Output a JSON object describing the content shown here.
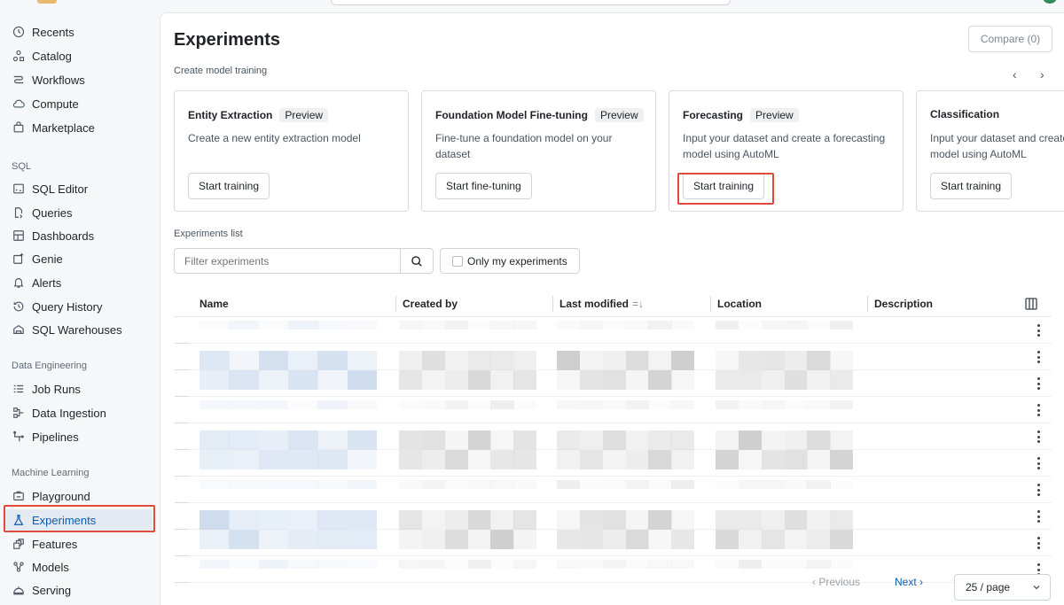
{
  "sidebar": {
    "top_items": [
      {
        "label": "Recents",
        "icon": "clock-icon"
      },
      {
        "label": "Catalog",
        "icon": "catalog-icon"
      },
      {
        "label": "Workflows",
        "icon": "workflows-icon"
      },
      {
        "label": "Compute",
        "icon": "cloud-icon"
      },
      {
        "label": "Marketplace",
        "icon": "store-icon"
      }
    ],
    "sql_section": "SQL",
    "sql_items": [
      {
        "label": "SQL Editor",
        "icon": "terminal-icon"
      },
      {
        "label": "Queries",
        "icon": "query-icon"
      },
      {
        "label": "Dashboards",
        "icon": "dashboard-icon"
      },
      {
        "label": "Genie",
        "icon": "sparkle-icon"
      },
      {
        "label": "Alerts",
        "icon": "bell-icon"
      },
      {
        "label": "Query History",
        "icon": "history-icon"
      },
      {
        "label": "SQL Warehouses",
        "icon": "warehouse-icon"
      }
    ],
    "de_section": "Data Engineering",
    "de_items": [
      {
        "label": "Job Runs",
        "icon": "list-icon"
      },
      {
        "label": "Data Ingestion",
        "icon": "ingestion-icon"
      },
      {
        "label": "Pipelines",
        "icon": "pipeline-icon"
      }
    ],
    "ml_section": "Machine Learning",
    "ml_items": [
      {
        "label": "Playground",
        "icon": "chat-icon"
      },
      {
        "label": "Experiments",
        "icon": "flask-icon",
        "active": true
      },
      {
        "label": "Features",
        "icon": "features-icon"
      },
      {
        "label": "Models",
        "icon": "models-icon"
      },
      {
        "label": "Serving",
        "icon": "serving-icon"
      }
    ]
  },
  "main": {
    "title": "Experiments",
    "compare_label": "Compare (0)",
    "create_label": "Create model training",
    "carousel_prev": "‹",
    "carousel_next": "›",
    "cards": [
      {
        "title": "Entity Extraction",
        "badge": "Preview",
        "description": "Create a new entity extraction model",
        "button": "Start training"
      },
      {
        "title": "Foundation Model Fine-tuning",
        "badge": "Preview",
        "description": "Fine-tune a foundation model on your dataset",
        "button": "Start fine-tuning"
      },
      {
        "title": "Forecasting",
        "badge": "Preview",
        "description": "Input your dataset and create a forecasting model using AutoML",
        "button": "Start training"
      },
      {
        "title": "Classification",
        "badge": "",
        "description": "Input your dataset and create a classification model using AutoML",
        "button": "Start training"
      }
    ],
    "list_label": "Experiments list",
    "filter_placeholder": "Filter experiments",
    "only_mine_label": "Only my experiments",
    "columns": [
      "Name",
      "Created by",
      "Last modified",
      "Location",
      "Description"
    ],
    "sort_indicator": "=↓",
    "row_count": 10,
    "pagination": {
      "previous": "‹ Previous",
      "next": "Next ›",
      "per_page": "25 / page"
    }
  },
  "colors": {
    "accent": "#0b5cad",
    "highlight": "#e04a3a",
    "active_bg": "#e4eaf2"
  }
}
